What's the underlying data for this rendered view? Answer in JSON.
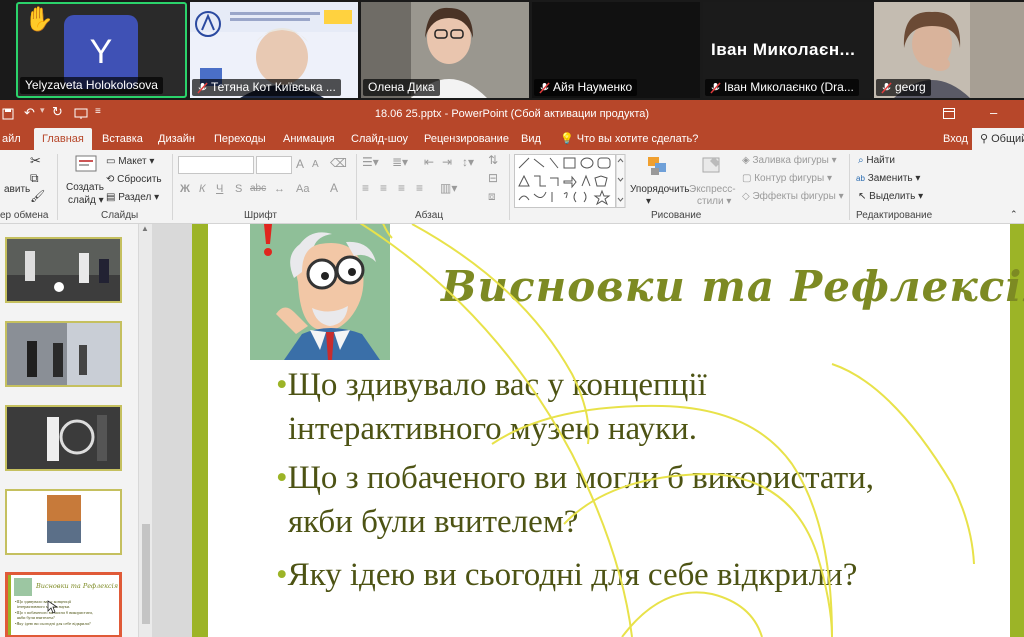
{
  "participants": [
    {
      "name": "Yelyzaveta Holokolosova",
      "avatar_letter": "Y",
      "hand_raised": true,
      "active_speaker": true
    },
    {
      "name": "Тетяна Кот Київська ...",
      "muted": true
    },
    {
      "name": "Олена Дика",
      "muted": false
    },
    {
      "name": "Айя Науменко",
      "muted": true
    },
    {
      "name": "Іван Миколаєнко (Dra...",
      "camera_name": "Іван  Миколаєн...",
      "muted": true
    },
    {
      "name": "georg",
      "muted": true
    }
  ],
  "window": {
    "title": "18.06 25.pptx  -  PowerPoint (Сбой активации продукта)",
    "login": "Вход",
    "share": "Общий"
  },
  "tabs": [
    "айл",
    "Главная",
    "Вставка",
    "Дизайн",
    "Переходы",
    "Анимация",
    "Слайд-шоу",
    "Рецензирование",
    "Вид"
  ],
  "tell_me": "Что вы хотите сделать?",
  "ribbon": {
    "clipboard": {
      "paste": "авить",
      "label": "ер обмена"
    },
    "slides": {
      "create": "Создать",
      "slide": "слайд",
      "layout": "Макет",
      "reset": "Сбросить",
      "section": "Раздел",
      "label": "Слайды"
    },
    "font": {
      "bold": "Ж",
      "italic": "К",
      "underline": "Ч",
      "strike": "S",
      "spacing": "abc",
      "size_up": "A",
      "size_down": "A",
      "color": "A",
      "label": "Шрифт"
    },
    "paragraph": {
      "label": "Абзац"
    },
    "drawing": {
      "arrange": "Упорядочить",
      "express": "Экспресс-",
      "styles": "стили",
      "fill": "Заливка фигуры",
      "outline": "Контур фигуры",
      "effects": "Эффекты фигуры",
      "label": "Рисование"
    },
    "editing": {
      "find": "Найти",
      "replace": "Заменить",
      "select": "Выделить",
      "label": "Редактирование"
    }
  },
  "slide": {
    "title": "Висновки та Рефлексія",
    "bullets": [
      {
        "lines": [
          "Що здивувало вас у концепції",
          "інтерактивного музею науки."
        ]
      },
      {
        "lines": [
          "Що з побаченого ви могли б використати,",
          "якби були вчителем?"
        ]
      },
      {
        "lines": [
          "Яку ідею ви сьогодні для себе відкрили?"
        ]
      }
    ]
  },
  "thumbnail_selected": {
    "title": "Висновки та Рефлексія",
    "line1": "•Що здивувало вас у концепції",
    "line2": "інтерактивного музею науки.",
    "line3": "•Що з побаченого ви могли б використати,",
    "line4": "якби були вчителем?",
    "line5": "•Яку ідею ви сьогодні для себе відкрили?"
  },
  "colors": {
    "ppt_brand": "#b7472a",
    "slide_accent": "#9cb427",
    "active_speaker": "#2bd36b",
    "annotation": "#e8e24a"
  }
}
